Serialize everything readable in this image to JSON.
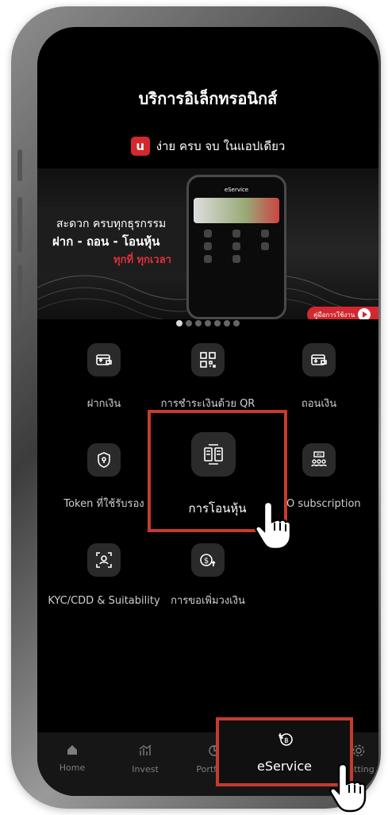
{
  "screen": {
    "title": "บริการอิเล็กทรอนิกส์",
    "promo": {
      "logo_letter": "u",
      "text": "ง่าย ครบ จบ ในแอปเดียว"
    }
  },
  "banner": {
    "line1": "สะดวก ครบทุกธุรกรรม",
    "line2": "ฝาก - ถอน - โอนหุ้น",
    "line3": "ทุกที่ ทุกเวลา",
    "manual_label": "คู่มือการใช้งาน",
    "phone_title": "eService",
    "page_count": 7,
    "active_page": 1
  },
  "services": [
    {
      "label": "ฝากเงิน",
      "icon": "wallet-deposit-icon"
    },
    {
      "label": "การชำระเงินด้วย QR",
      "icon": "qr-code-icon"
    },
    {
      "label": "ถอนเงิน",
      "icon": "wallet-withdraw-icon"
    },
    {
      "label": "Token ที่ใช้รับรอง",
      "icon": "shield-lock-icon"
    },
    {
      "label": "การโอนหุ้น",
      "icon": "stock-transfer-icon"
    },
    {
      "label": "IPO subscription",
      "icon": "ipo-icon"
    },
    {
      "label": "KYC/CDD & Suitability",
      "icon": "kyc-face-icon"
    },
    {
      "label": "การขอเพิ่มวงเงิน",
      "icon": "credit-increase-icon"
    }
  ],
  "nav": {
    "items": [
      {
        "label": "Home",
        "icon": "home-icon"
      },
      {
        "label": "Invest",
        "icon": "invest-chart-icon"
      },
      {
        "label": "Portfolio",
        "icon": "portfolio-pie-icon"
      },
      {
        "label": "eService",
        "icon": "eservice-icon"
      },
      {
        "label": "Setting",
        "icon": "setting-icon"
      }
    ]
  },
  "colors": {
    "accent": "#d2282e",
    "highlight": "#c63b2f",
    "background": "#000000"
  }
}
